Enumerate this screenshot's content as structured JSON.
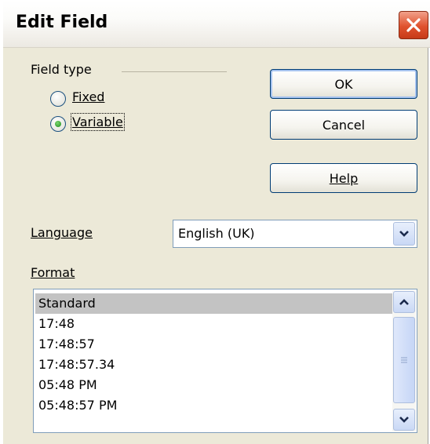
{
  "window": {
    "title": "Edit Field"
  },
  "field_type": {
    "label": "Field type",
    "options": [
      {
        "label": "Fixed",
        "selected": false
      },
      {
        "label": "Variable",
        "selected": true
      }
    ]
  },
  "buttons": {
    "ok": "OK",
    "cancel": "Cancel",
    "help": "Help"
  },
  "language": {
    "label": "Language",
    "value": "English (UK)"
  },
  "format": {
    "label": "Format",
    "items": [
      "Standard",
      "17:48",
      "17:48:57",
      "17:48:57.34",
      "05:48 PM",
      "05:48:57 PM"
    ],
    "selected_index": 0
  },
  "colors": {
    "close_button": "#e0522e",
    "selection": "#c3c3c3",
    "border_accent": "#7f9db9"
  }
}
